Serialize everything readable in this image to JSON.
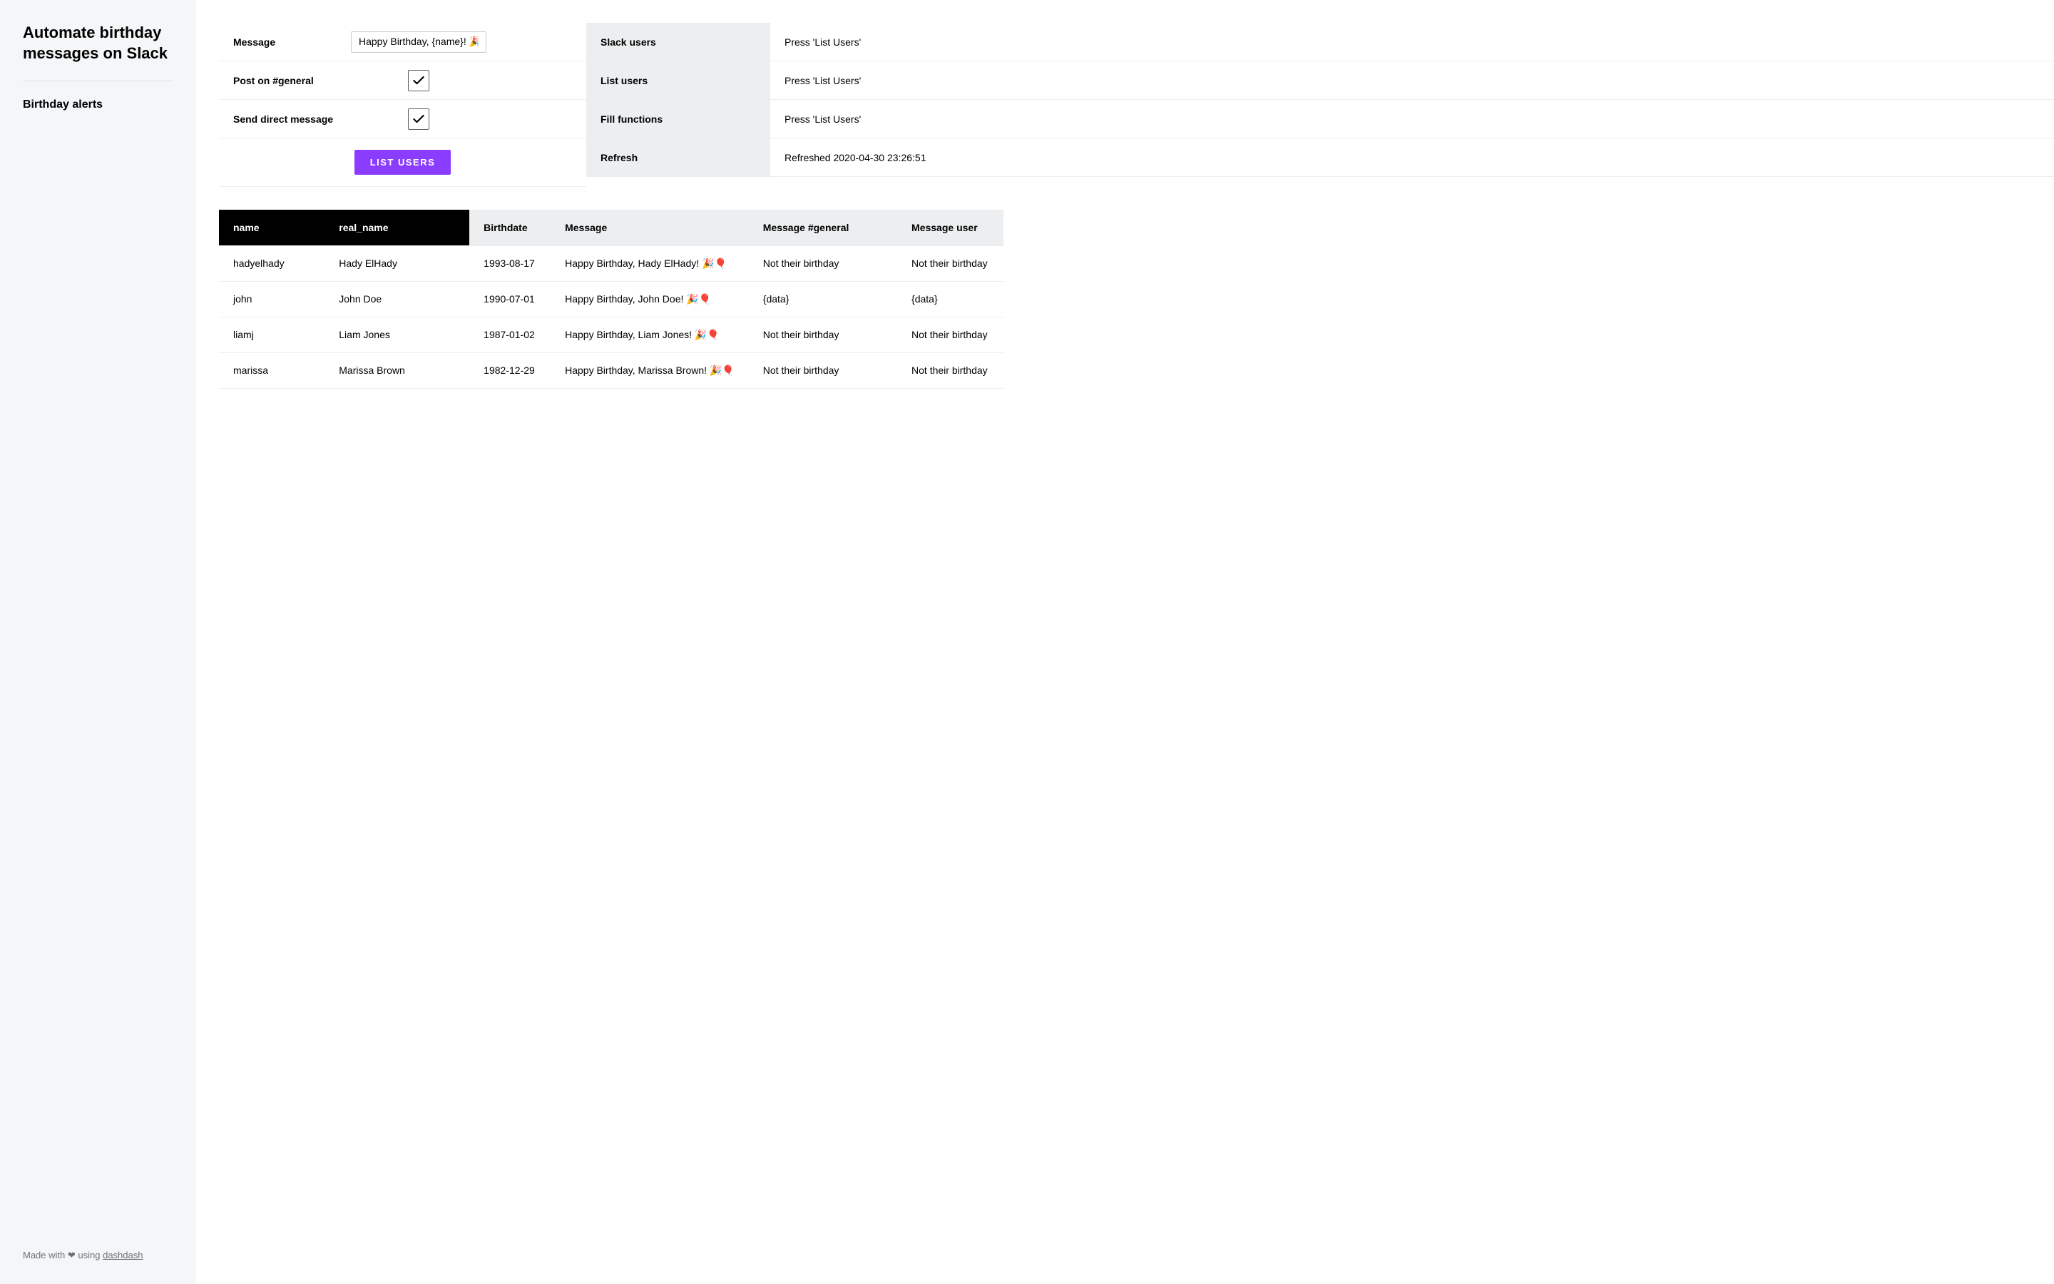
{
  "sidebar": {
    "title": "Automate birthday messages on Slack",
    "nav_item": "Birthday alerts",
    "footer_prefix": "Made with ",
    "footer_mid": " using ",
    "footer_link": "dashdash"
  },
  "controls": {
    "message_label": "Message",
    "message_value": "Happy Birthday, {name}! 🎉🎈",
    "post_general_label": "Post on #general",
    "send_dm_label": "Send direct message",
    "list_users_button": "LIST USERS"
  },
  "status": {
    "rows": [
      {
        "label": "Slack users",
        "value": "Press 'List Users'"
      },
      {
        "label": "List users",
        "value": "Press 'List Users'"
      },
      {
        "label": "Fill functions",
        "value": "Press 'List Users'"
      },
      {
        "label": "Refresh",
        "value": "Refreshed 2020-04-30 23:26:51"
      }
    ]
  },
  "table": {
    "headers": {
      "name": "name",
      "real_name": "real_name",
      "birthdate": "Birthdate",
      "message": "Message",
      "message_general": "Message #general",
      "message_user": "Message user"
    },
    "rows": [
      {
        "name": "hadyelhady",
        "real_name": "Hady ElHady",
        "birthdate": "1993-08-17",
        "message": "Happy Birthday, Hady ElHady! 🎉🎈",
        "message_general": "Not their birthday",
        "message_user": "Not their birthday"
      },
      {
        "name": "john",
        "real_name": "John Doe",
        "birthdate": "1990-07-01",
        "message": "Happy Birthday, John Doe! 🎉🎈",
        "message_general": "{data}",
        "message_user": "{data}"
      },
      {
        "name": "liamj",
        "real_name": "Liam Jones",
        "birthdate": "1987-01-02",
        "message": "Happy Birthday, Liam Jones! 🎉🎈",
        "message_general": "Not their birthday",
        "message_user": "Not their birthday"
      },
      {
        "name": "marissa",
        "real_name": "Marissa Brown",
        "birthdate": "1982-12-29",
        "message": "Happy Birthday, Marissa Brown! 🎉🎈",
        "message_general": "Not their birthday",
        "message_user": "Not their birthday"
      }
    ]
  }
}
